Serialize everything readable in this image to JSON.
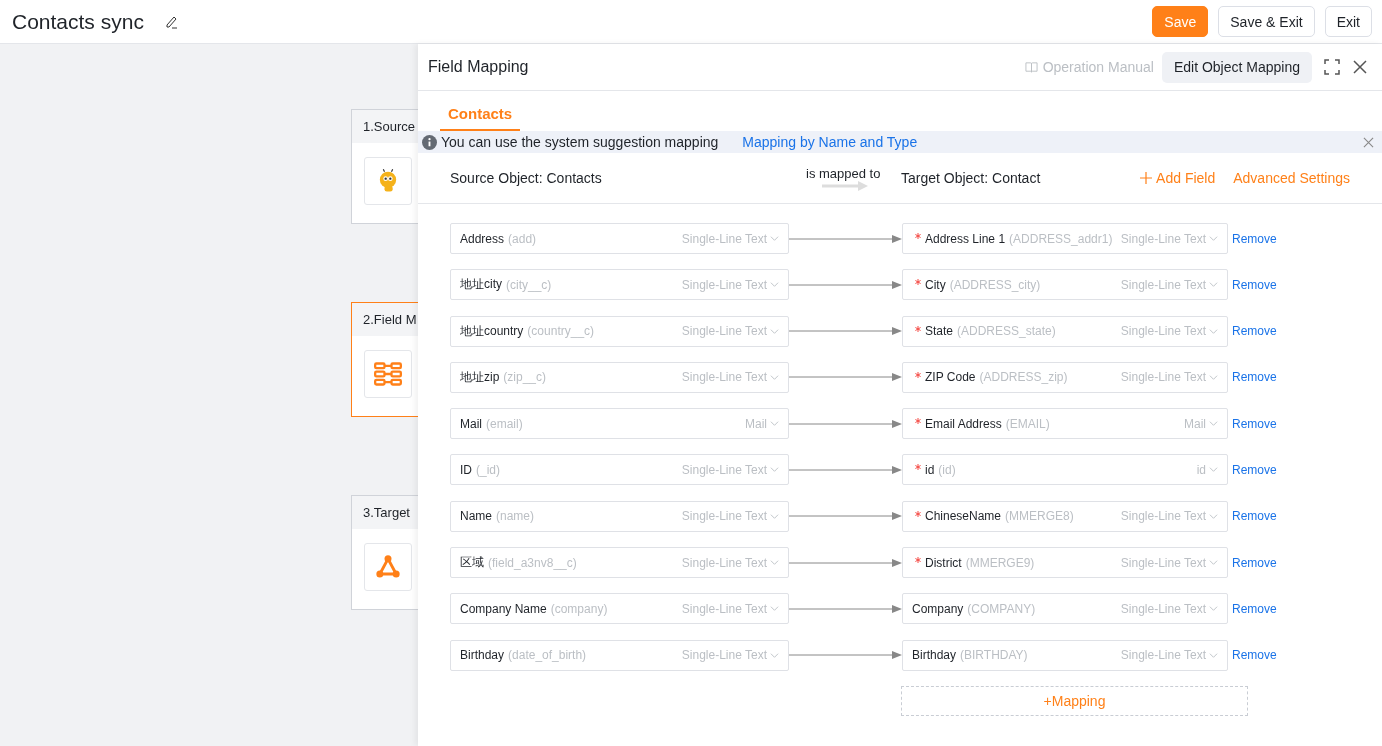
{
  "header": {
    "title": "Contacts sync",
    "buttons": [
      {
        "label": "Save",
        "kind": "primary"
      },
      {
        "label": "Save & Exit",
        "kind": "default"
      },
      {
        "label": "Exit",
        "kind": "default"
      }
    ]
  },
  "steps": [
    {
      "label": "1.Source",
      "kind": "bee",
      "selected": false
    },
    {
      "label": "2.Field M",
      "kind": "mapping",
      "selected": true
    },
    {
      "label": "3.Target",
      "kind": "nodes",
      "selected": false
    }
  ],
  "panel": {
    "title": "Field Mapping",
    "manual": "Operation Manual",
    "edit_button": "Edit Object Mapping",
    "tabs": [
      {
        "label": "Contacts",
        "selected": true
      }
    ],
    "notice": {
      "text": "You can use the system suggestion mapping",
      "link": "Mapping by Name and Type"
    },
    "source_object": {
      "label": "Source Object:",
      "value": "Contacts"
    },
    "mapped_label": "is mapped to",
    "target_object": {
      "label": "Target Object:",
      "value": "Contact"
    },
    "add_field": "Add Field",
    "advanced": "Advanced Settings",
    "mappings": [
      {
        "source": {
          "name": "Address",
          "api": "(add)",
          "type": "Single-Line Text"
        },
        "target": {
          "name": "Address Line 1",
          "api": "(ADDRESS_addr1)",
          "type": "Single-Line Text",
          "required": true
        },
        "action": "Remove"
      },
      {
        "source": {
          "name": "地址city",
          "api": "(city__c)",
          "type": "Single-Line Text"
        },
        "target": {
          "name": "City",
          "api": "(ADDRESS_city)",
          "type": "Single-Line Text",
          "required": true
        },
        "action": "Remove"
      },
      {
        "source": {
          "name": "地址country",
          "api": "(country__c)",
          "type": "Single-Line Text"
        },
        "target": {
          "name": "State",
          "api": "(ADDRESS_state)",
          "type": "Single-Line Text",
          "required": true
        },
        "action": "Remove"
      },
      {
        "source": {
          "name": "地址zip",
          "api": "(zip__c)",
          "type": "Single-Line Text"
        },
        "target": {
          "name": "ZIP Code",
          "api": "(ADDRESS_zip)",
          "type": "Single-Line Text",
          "required": true
        },
        "action": "Remove"
      },
      {
        "source": {
          "name": "Mail",
          "api": "(email)",
          "type": "Mail"
        },
        "target": {
          "name": "Email Address",
          "api": "(EMAIL)",
          "type": "Mail",
          "required": true
        },
        "action": "Remove"
      },
      {
        "source": {
          "name": "ID",
          "api": "(_id)",
          "type": "Single-Line Text"
        },
        "target": {
          "name": "id",
          "api": "(id)",
          "type": "id",
          "required": true
        },
        "action": "Remove"
      },
      {
        "source": {
          "name": "Name",
          "api": "(name)",
          "type": "Single-Line Text"
        },
        "target": {
          "name": "ChineseName",
          "api": "(MMERGE8)",
          "type": "Single-Line Text",
          "required": true
        },
        "action": "Remove"
      },
      {
        "source": {
          "name": "区域",
          "api": "(field_a3nv8__c)",
          "type": "Single-Line Text"
        },
        "target": {
          "name": "District",
          "api": "(MMERGE9)",
          "type": "Single-Line Text",
          "required": true
        },
        "action": "Remove"
      },
      {
        "source": {
          "name": "Company Name",
          "api": "(company)",
          "type": "Single-Line Text"
        },
        "target": {
          "name": "Company",
          "api": "(COMPANY)",
          "type": "Single-Line Text",
          "required": false
        },
        "action": "Remove"
      },
      {
        "source": {
          "name": "Birthday",
          "api": "(date_of_birth)",
          "type": "Single-Line Text"
        },
        "target": {
          "name": "Birthday",
          "api": "(BIRTHDAY)",
          "type": "Single-Line Text",
          "required": false
        },
        "action": "Remove"
      }
    ],
    "add_mapping": "+Mapping"
  }
}
